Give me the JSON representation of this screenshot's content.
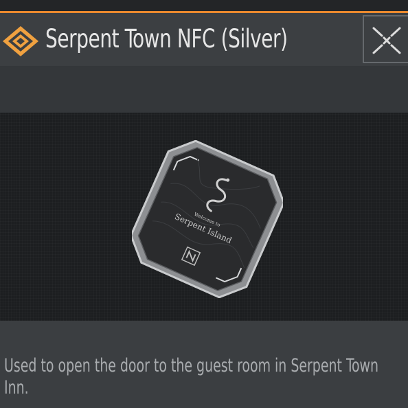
{
  "dialog": {
    "title": "Serpent Town NFC (Silver)",
    "header_icon": "diamond-emblem-icon",
    "close_icon": "close-icon",
    "accent_color": "#e9892e"
  },
  "item_card": {
    "greeting": "Welcome to",
    "place": "Serpent Island",
    "emblem": "serpent-icon",
    "chip": "nfc-chip-icon"
  },
  "description": "Used to open the door to the guest room in Serpent Town Inn."
}
